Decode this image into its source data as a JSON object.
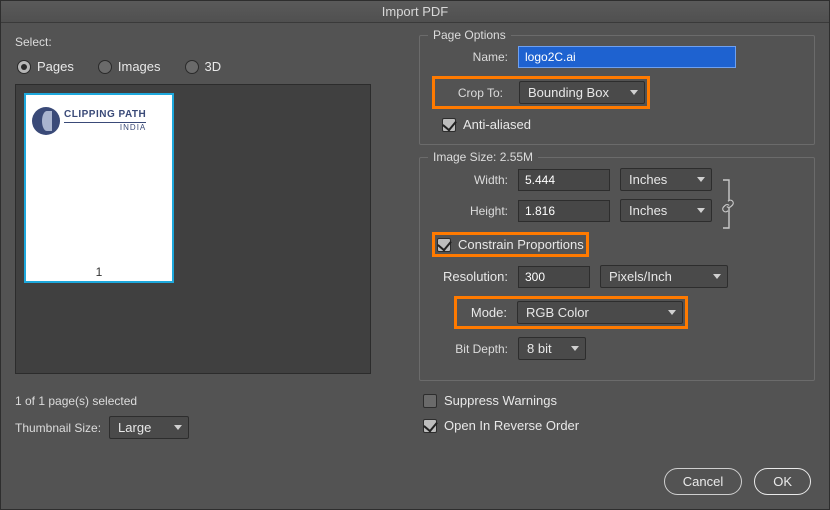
{
  "title": "Import PDF",
  "left": {
    "section_label": "Select:",
    "radios": {
      "pages": "Pages",
      "images": "Images",
      "threeD": "3D",
      "selected": "pages"
    },
    "thumb": {
      "page_number": "1",
      "logo_line1_a": "CLIPPING",
      "logo_line1_b": "PATH",
      "logo_line2": "INDIA"
    },
    "status": "1 of 1 page(s) selected",
    "thumb_size_label": "Thumbnail Size:",
    "thumb_size_value": "Large"
  },
  "page_options": {
    "legend": "Page Options",
    "name_label": "Name:",
    "name_value": "logo2C.ai",
    "crop_label": "Crop To:",
    "crop_value": "Bounding Box",
    "anti_aliased_label": "Anti-aliased",
    "anti_aliased_checked": true
  },
  "image_size": {
    "legend": "Image Size: 2.55M",
    "width_label": "Width:",
    "width_value": "5.444",
    "width_unit": "Inches",
    "height_label": "Height:",
    "height_value": "1.816",
    "height_unit": "Inches",
    "constrain_label": "Constrain Proportions",
    "constrain_checked": true,
    "resolution_label": "Resolution:",
    "resolution_value": "300",
    "resolution_unit": "Pixels/Inch",
    "mode_label": "Mode:",
    "mode_value": "RGB Color",
    "bitdepth_label": "Bit Depth:",
    "bitdepth_value": "8 bit"
  },
  "footer": {
    "suppress_label": "Suppress Warnings",
    "suppress_checked": false,
    "reverse_label": "Open In Reverse Order",
    "reverse_checked": true,
    "cancel": "Cancel",
    "ok": "OK"
  }
}
